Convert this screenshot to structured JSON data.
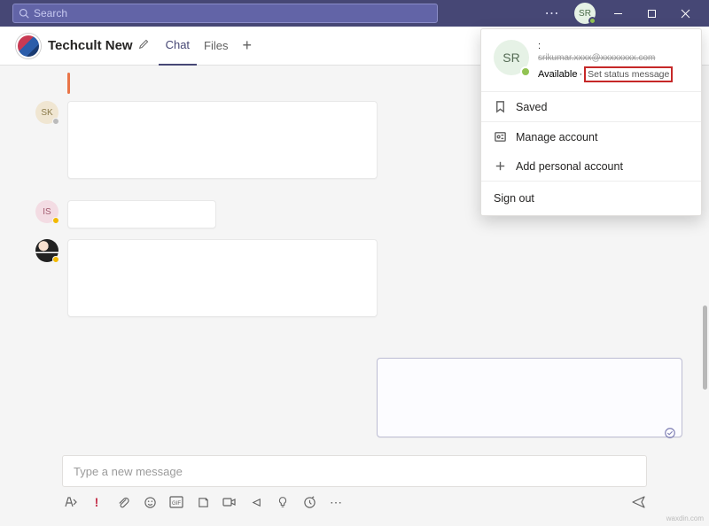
{
  "titlebar": {
    "search_placeholder": "Search",
    "avatar_initials": "SR"
  },
  "header": {
    "title": "Techcult New",
    "tabs": {
      "chat": "Chat",
      "files": "Files"
    }
  },
  "avatars": {
    "sk": "SK",
    "is": "IS"
  },
  "panel": {
    "avatar_initials": "SR",
    "email": "srikumar.xxxx@xxxxxxxx.com",
    "status": "Available",
    "separator": "·",
    "set_status": "Set status message",
    "saved": "Saved",
    "manage": "Manage account",
    "add": "Add personal account",
    "signout": "Sign out"
  },
  "compose": {
    "placeholder": "Type a new message"
  },
  "watermark": "waxdin.com"
}
